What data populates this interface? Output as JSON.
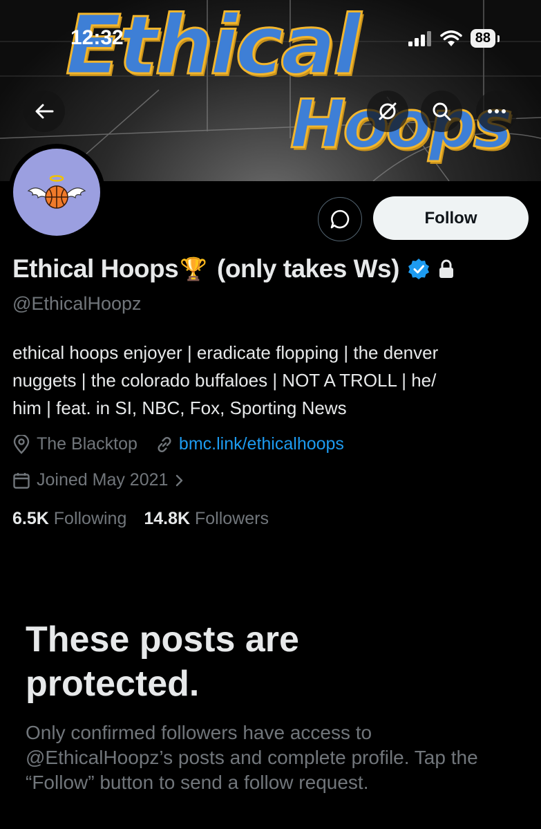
{
  "status_bar": {
    "time": "12:32",
    "battery": "88"
  },
  "banner": {
    "line1": "Ethical",
    "line2": "Hoops"
  },
  "actions": {
    "follow_label": "Follow"
  },
  "profile": {
    "name": "Ethical Hoops",
    "name_suffix": "(only takes Ws)",
    "trophy_emoji": "🏆",
    "handle": "@EthicalHoopz",
    "bio_lines": [
      "ethical hoops enjoyer | eradicate flopping | the denver",
      "nuggets | the colorado buffaloes | NOT A TROLL | he/",
      "him | feat. in SI, NBC, Fox, Sporting News"
    ],
    "location": "The Blacktop",
    "website": "bmc.link/ethicalhoops",
    "joined": "Joined May 2021",
    "following_count": "6.5K",
    "following_label": "Following",
    "followers_count": "14.8K",
    "followers_label": "Followers"
  },
  "protected": {
    "title_line1": "These posts are",
    "title_line2": "protected.",
    "body_lines": [
      "Only confirmed followers have access to",
      "@EthicalHoopz’s posts and complete profile. Tap the",
      "“Follow” button to send a follow request."
    ]
  },
  "colors": {
    "accent": "#1d9bf0",
    "muted": "#71767b",
    "avatar_bg": "#9b9fe0"
  }
}
